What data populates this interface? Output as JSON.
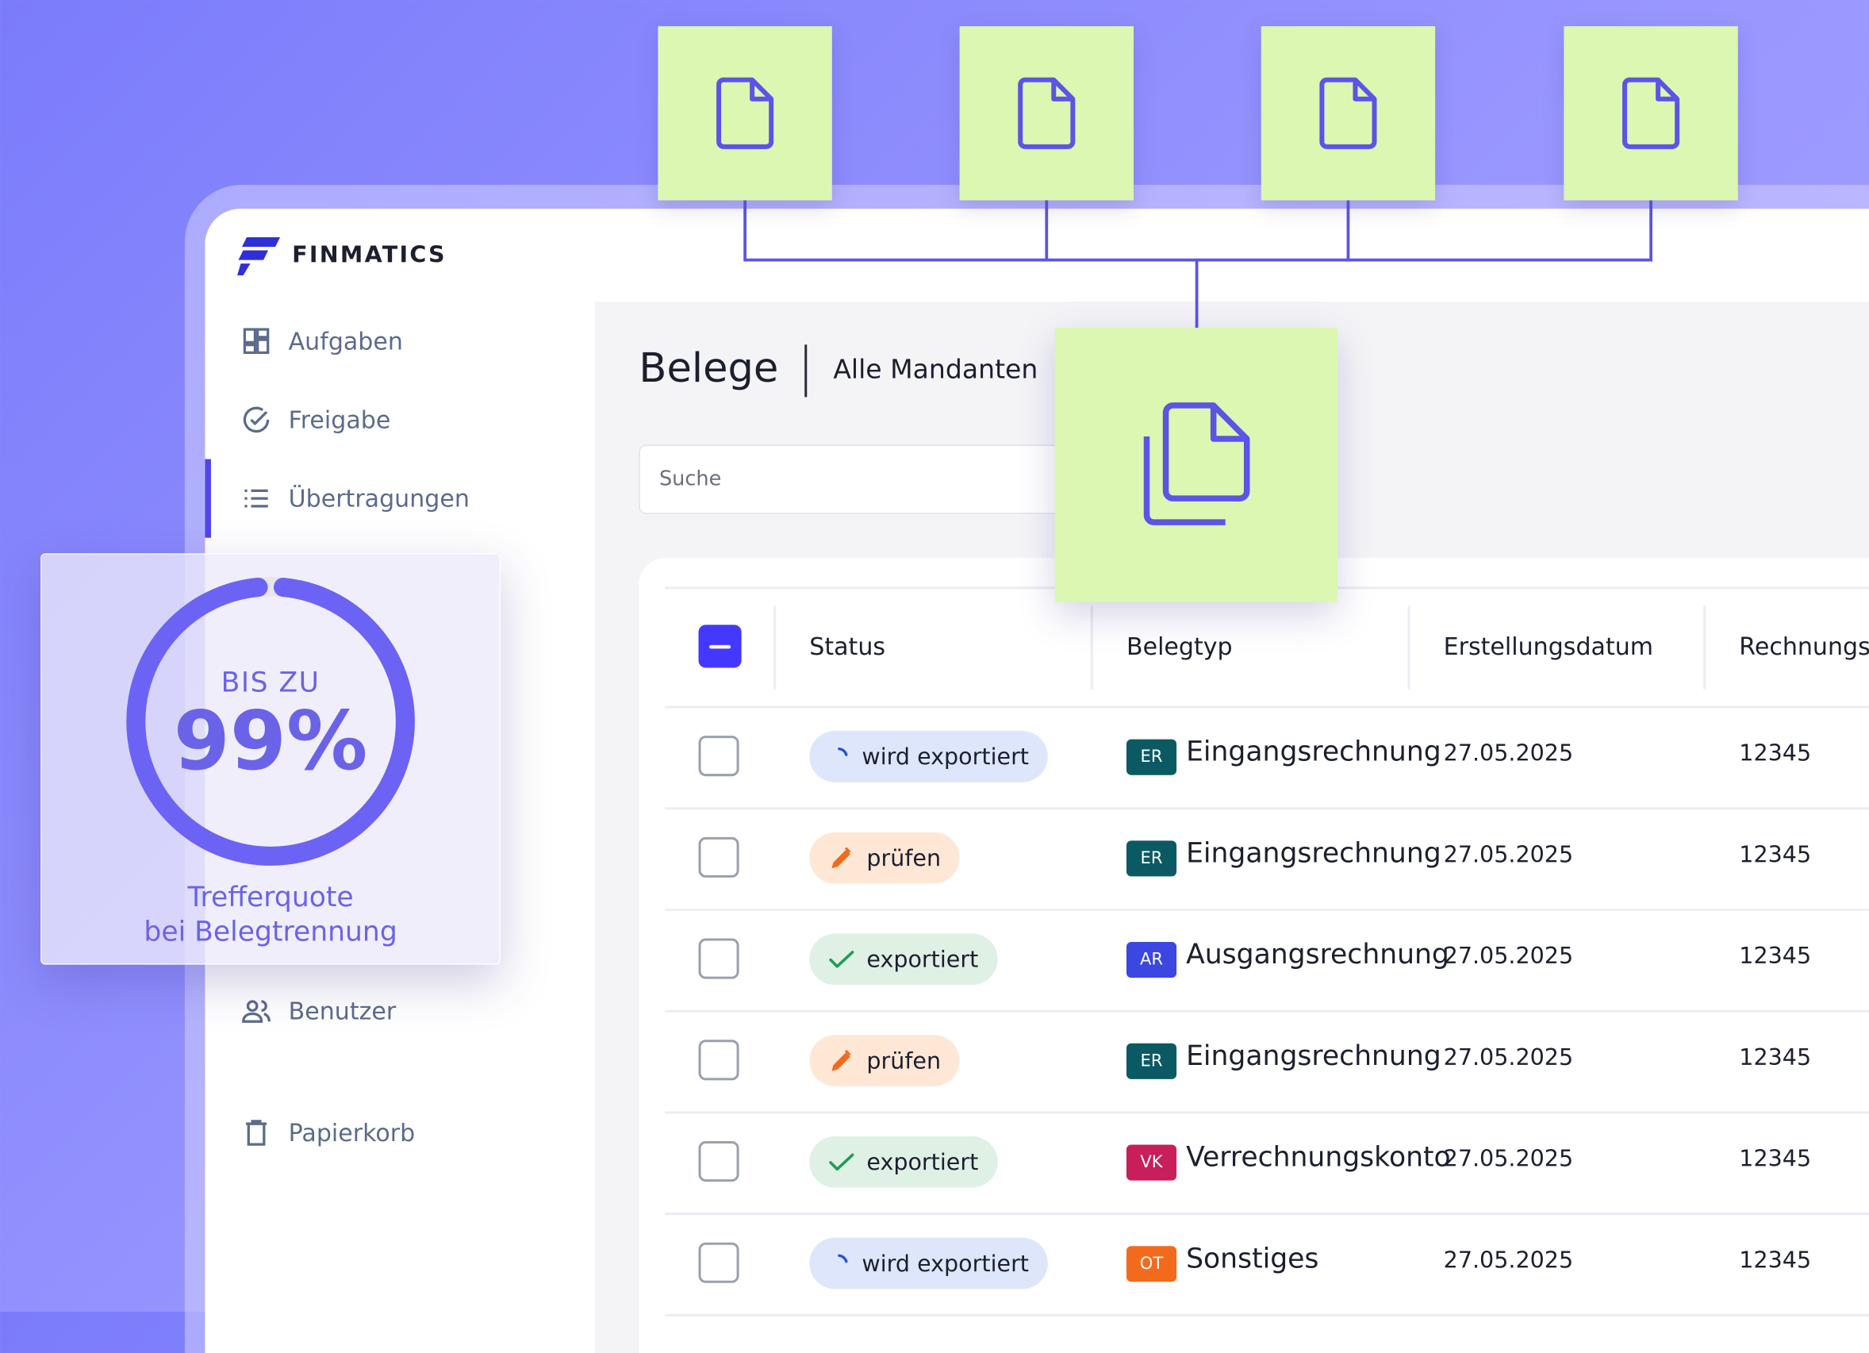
{
  "brand": {
    "name": "FINMATICS",
    "accent": "#4f46e5"
  },
  "sidebar": {
    "items": [
      {
        "label": "Aufgaben",
        "icon": "dashboard-icon"
      },
      {
        "label": "Freigabe",
        "icon": "check-circle-icon"
      },
      {
        "label": "Übertragungen",
        "icon": "list-icon",
        "active": true
      },
      {
        "label": "Benutzer",
        "icon": "users-icon"
      },
      {
        "label": "Papierkorb",
        "icon": "trash-icon"
      }
    ]
  },
  "header": {
    "title": "Belege",
    "mandant": "Alle Mandanten"
  },
  "search": {
    "placeholder": "Suche"
  },
  "table": {
    "columns": [
      "Status",
      "Belegtyp",
      "Erstellungsdatum",
      "Rechnungs"
    ],
    "rows": [
      {
        "status": "wird exportiert",
        "status_kind": "blue",
        "badge": "ER",
        "badge_color": "#0b5a63",
        "type": "Eingangsrechnung",
        "date": "27.05.2025",
        "number": "12345"
      },
      {
        "status": "prüfen",
        "status_kind": "orange",
        "badge": "ER",
        "badge_color": "#0b5a63",
        "type": "Eingangsrechnung",
        "date": "27.05.2025",
        "number": "12345"
      },
      {
        "status": "exportiert",
        "status_kind": "green",
        "badge": "AR",
        "badge_color": "#3b47e0",
        "type": "Ausgangsrechnung",
        "date": "27.05.2025",
        "number": "12345"
      },
      {
        "status": "prüfen",
        "status_kind": "orange",
        "badge": "ER",
        "badge_color": "#0b5a63",
        "type": "Eingangsrechnung",
        "date": "27.05.2025",
        "number": "12345"
      },
      {
        "status": "exportiert",
        "status_kind": "green",
        "badge": "VK",
        "badge_color": "#c81e5a",
        "type": "Verrechnungskonto",
        "date": "27.05.2025",
        "number": "12345"
      },
      {
        "status": "wird exportiert",
        "status_kind": "blue",
        "badge": "OT",
        "badge_color": "#f26b1d",
        "type": "Sonstiges",
        "date": "27.05.2025",
        "number": "12345"
      }
    ]
  },
  "stat": {
    "prefix": "BIS ZU",
    "value": "99%",
    "caption_line1": "Trefferquote",
    "caption_line2": "bei Belegtrennung",
    "ring_fraction": 0.97
  },
  "doc_tiles": {
    "icon": "document-icon",
    "count": 4,
    "merged_icon": "documents-stack-icon"
  }
}
